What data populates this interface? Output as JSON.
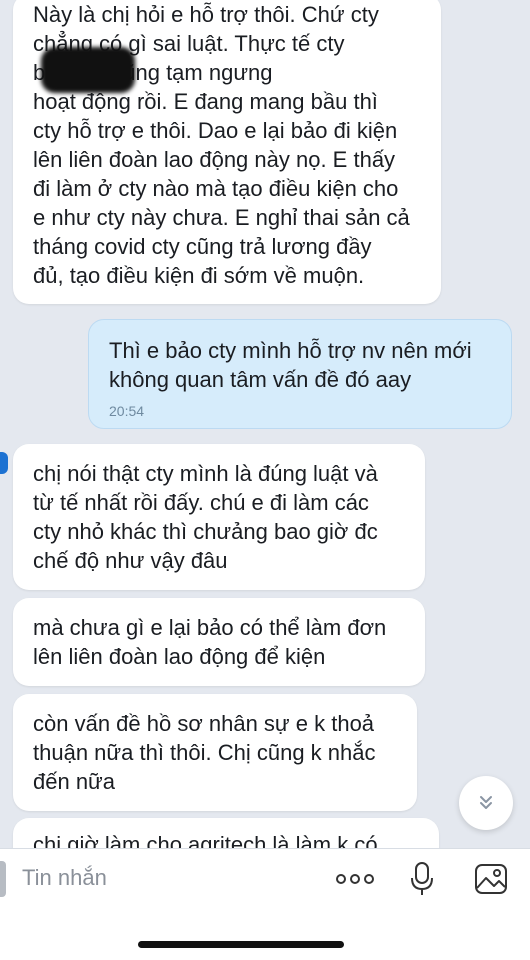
{
  "messages": [
    {
      "direction": "incoming",
      "text": "Này là chị hỏi e hỗ trợ thôi. Chứ cty\nchẳng có gì sai luật. Thực tế cty\n                 bây giờ cũng tạm ngưng\nhoạt động rồi. E đang mang bầu thì\ncty hỗ trợ e thôi. Dao e lại bảo đi kiện\nlên liên đoàn lao động này nọ. E thấy\nđi làm ở cty nào mà tạo điều kiện cho\ne như cty này chưa. E nghỉ thai sản cả\ntháng covid cty cũng trả lương đầy\nđủ, tạo điều kiện đi sớm về muộn."
    },
    {
      "direction": "outgoing",
      "text": "Thì e bảo cty mình hỗ trợ nv nên mới\nkhông quan tâm vấn đề đó aay",
      "time": "20:54"
    },
    {
      "direction": "incoming",
      "text": "chị nói thật cty mình là đúng luật và\ntừ tế nhất rồi đấy. chú e đi làm các\ncty nhỏ khác thì chưảng bao giờ đc\nchế độ như vậy đâu"
    },
    {
      "direction": "incoming",
      "text": "mà chưa gì e lại bảo có thể làm đơn\nlên liên đoàn lao động để kiện"
    },
    {
      "direction": "incoming",
      "text": "còn vấn đề hồ sơ nhân sự e k thoả\nthuận nữa thì thôi. Chị cũng k nhắc\nđến nữa"
    },
    {
      "direction": "incoming",
      "text": "chị giờ làm cho agritech là làm k có"
    }
  ],
  "input": {
    "placeholder": "Tin nhắn"
  },
  "icons": {
    "scroll_down": "chevron-double-down-icon",
    "more": "more-dots-icon",
    "mic": "microphone-icon",
    "image": "image-icon"
  },
  "colors": {
    "background": "#e4e8ef",
    "incoming_bubble": "#ffffff",
    "outgoing_bubble": "#d6ecfb",
    "time_text": "#6f8aa0",
    "accent": "#1d72d2"
  }
}
